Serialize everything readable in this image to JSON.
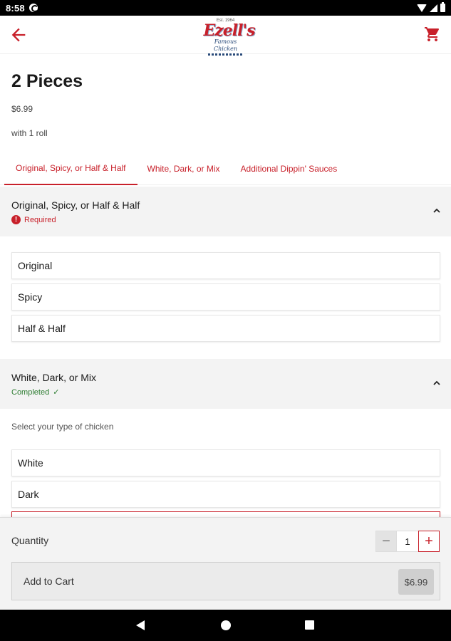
{
  "status_bar": {
    "time": "8:58"
  },
  "app_bar": {
    "logo": {
      "small_text": "Est. 1964",
      "brand": "Ezell's",
      "sub": "Famous Chicken"
    }
  },
  "item": {
    "title": "2 Pieces",
    "price": "$6.99",
    "description": "with 1 roll"
  },
  "tabs": [
    {
      "label": "Original, Spicy, or Half & Half",
      "active": true
    },
    {
      "label": "White, Dark, or Mix",
      "active": false
    },
    {
      "label": "Additional Dippin' Sauces",
      "active": false
    }
  ],
  "sections": [
    {
      "title": "Original, Spicy, or Half & Half",
      "status": "Required",
      "status_icon": "!",
      "options": [
        "Original",
        "Spicy",
        "Half & Half"
      ]
    },
    {
      "title": "White, Dark, or Mix",
      "status": "Completed",
      "status_icon": "✓",
      "helper": "Select your type of chicken",
      "options": [
        "White",
        "Dark",
        ""
      ]
    }
  ],
  "quantity": {
    "label": "Quantity",
    "value": "1",
    "minus": "−",
    "plus": "+"
  },
  "add_to_cart": {
    "label": "Add to Cart",
    "amount": "$6.99"
  },
  "colors": {
    "accent": "#c8202a",
    "completed": "#2e7d32",
    "panel": "#f3f3f3"
  }
}
